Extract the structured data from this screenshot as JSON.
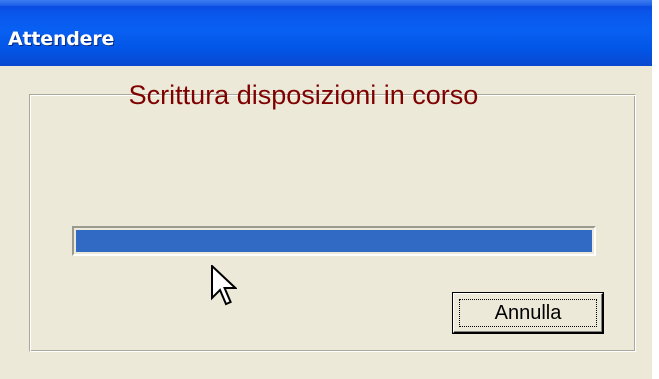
{
  "window": {
    "title": "Attendere"
  },
  "dialog": {
    "message": "Scrittura disposizioni in corso",
    "progress": 1.0,
    "cancel_label": "Annulla"
  },
  "colors": {
    "titlebar": "#0860f2",
    "window_bg": "#ece9d8",
    "message_text": "#7f0000",
    "progress_fill": "#316ac5"
  },
  "icons": {
    "cursor": "arrow-cursor-icon"
  }
}
